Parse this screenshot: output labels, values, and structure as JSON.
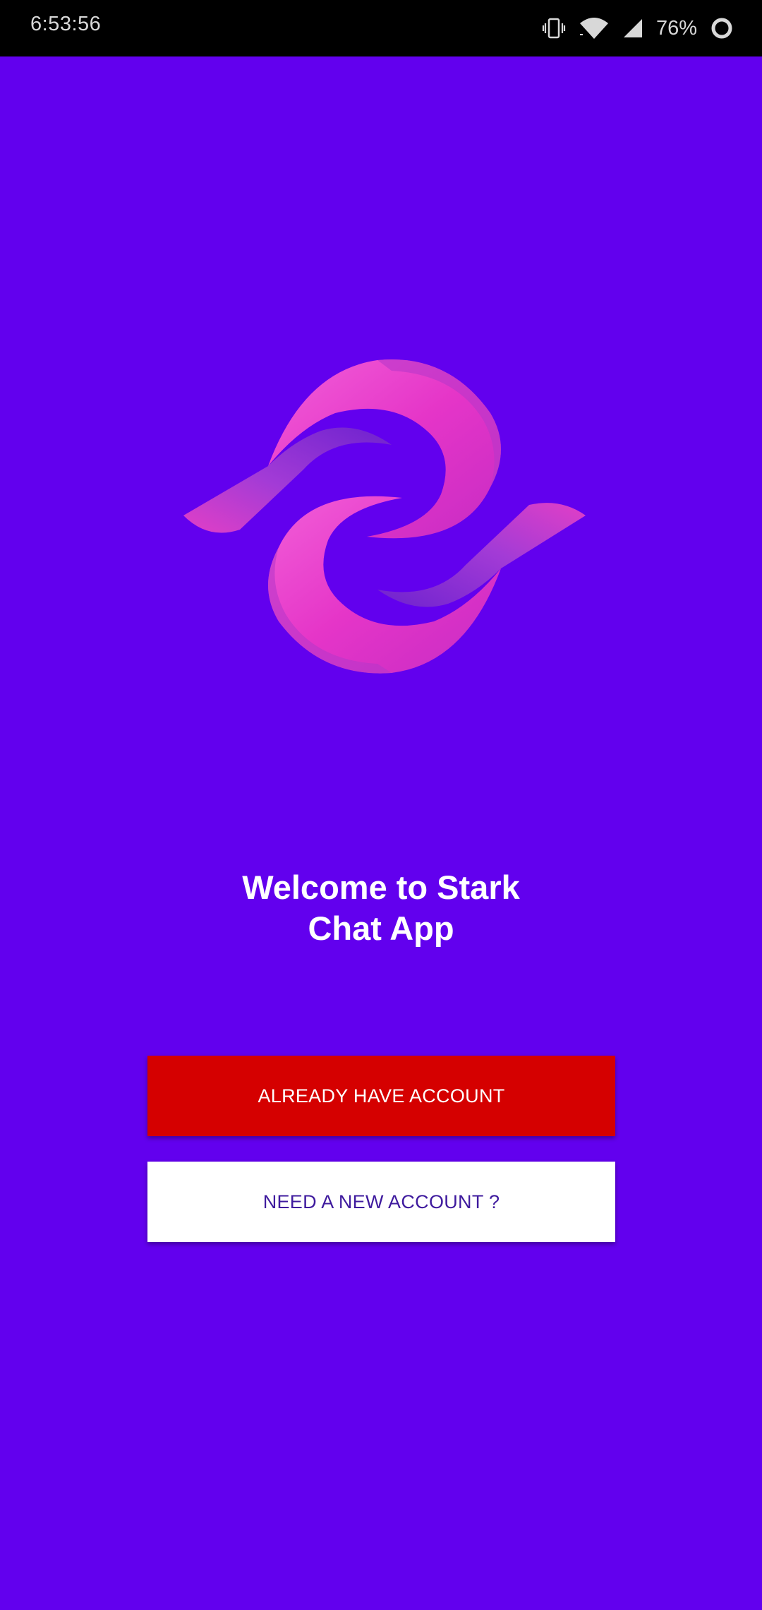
{
  "status_bar": {
    "time": "6:53:56",
    "battery_percent": "76%",
    "icons": [
      "vibrate-icon",
      "wifi-icon",
      "signal-icon",
      "battery-icon"
    ]
  },
  "welcome": {
    "line1": "Welcome to Stark",
    "line2": "Chat App"
  },
  "buttons": {
    "login_label": "ALREADY HAVE ACCOUNT",
    "register_label": "NEED A NEW ACCOUNT ?"
  },
  "colors": {
    "background": "#6200EE",
    "login_button": "#D50000",
    "register_button": "#FFFFFF",
    "register_text": "#3F1B9E",
    "logo_pink": "#EC38C8",
    "logo_purple": "#8A2BE2"
  }
}
